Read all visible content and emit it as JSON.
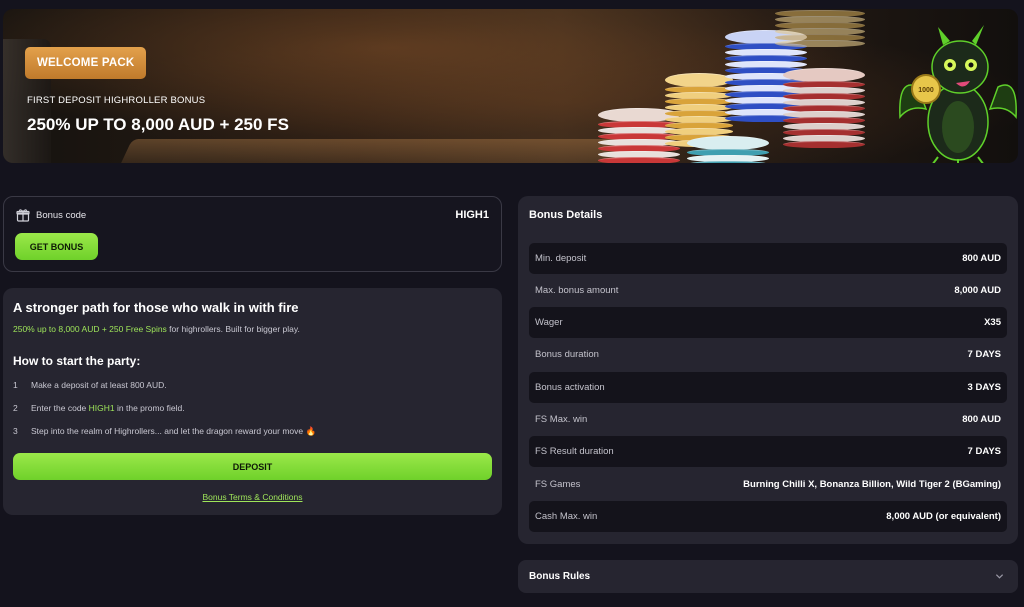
{
  "hero": {
    "badge": "WELCOME PACK",
    "subtitle": "FIRST DEPOSIT HIGHROLLER BONUS",
    "title": "250% UP TO 8,000 AUD + 250 FS",
    "coin_text": "1000"
  },
  "bonus_code": {
    "label": "Bonus code",
    "code": "HIGH1",
    "button": "GET BONUS"
  },
  "info": {
    "title": "A stronger path for those who walk in with fire",
    "desc_highlight": "250% up to 8,000 AUD + 250 Free Spins",
    "desc_rest": " for highrollers. Built for bigger play.",
    "howto_title": "How to start the party:",
    "steps": [
      {
        "num": "1",
        "pre": "Make a deposit of at least 800 AUD.",
        "hl": "",
        "post": ""
      },
      {
        "num": "2",
        "pre": "Enter the code ",
        "hl": "HIGH1",
        "post": " in the promo field."
      },
      {
        "num": "3",
        "pre": "Step into the realm of Highrollers... and let the dragon reward your move 🔥",
        "hl": "",
        "post": ""
      }
    ],
    "deposit_button": "DEPOSIT",
    "terms_link": "Bonus Terms & Conditions"
  },
  "details": {
    "title": "Bonus Details",
    "rows": [
      {
        "key": "Min. deposit",
        "value": "800 AUD"
      },
      {
        "key": "Max. bonus amount",
        "value": "8,000 AUD"
      },
      {
        "key": "Wager",
        "value": "X35"
      },
      {
        "key": "Bonus duration",
        "value": "7 DAYS"
      },
      {
        "key": "Bonus activation",
        "value": "3 DAYS"
      },
      {
        "key": "FS Max. win",
        "value": "800 AUD"
      },
      {
        "key": "FS Result duration",
        "value": "7 DAYS"
      },
      {
        "key": "FS Games",
        "value": "Burning Chilli X, Bonanza Billion, Wild Tiger 2 (BGaming)"
      },
      {
        "key": "Cash Max. win",
        "value": "8,000 AUD (or equivalent)"
      }
    ]
  },
  "rules": {
    "title": "Bonus Rules"
  },
  "colors": {
    "accent_green": "#8fe043",
    "badge_orange": "#d28d3a",
    "card_bg": "#262530",
    "page_bg": "#14131d"
  }
}
